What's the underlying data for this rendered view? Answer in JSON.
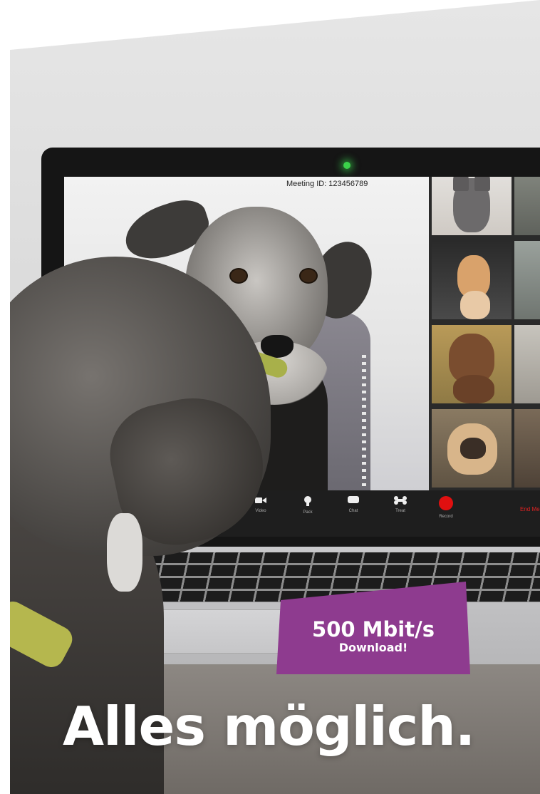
{
  "screen": {
    "meeting_id": "Meeting ID: 123456789",
    "toolbar": [
      {
        "label": "Video",
        "icon": "video-camera-icon"
      },
      {
        "label": "Pack",
        "icon": "trophy-icon"
      },
      {
        "label": "Chat",
        "icon": "chat-bubble-icon"
      },
      {
        "label": "Treat",
        "icon": "bone-icon"
      },
      {
        "label": "Record",
        "icon": "record-icon"
      }
    ],
    "end_meeting": "End Meeting"
  },
  "badge": {
    "speed": "500 Mbit/s",
    "sub": "Download!",
    "color": "#8e3b8f"
  },
  "headline": "Alles möglich.",
  "colors": {
    "record_red": "#e01010",
    "end_meeting_red": "#d22222",
    "webcam_green": "#3bd14a"
  }
}
